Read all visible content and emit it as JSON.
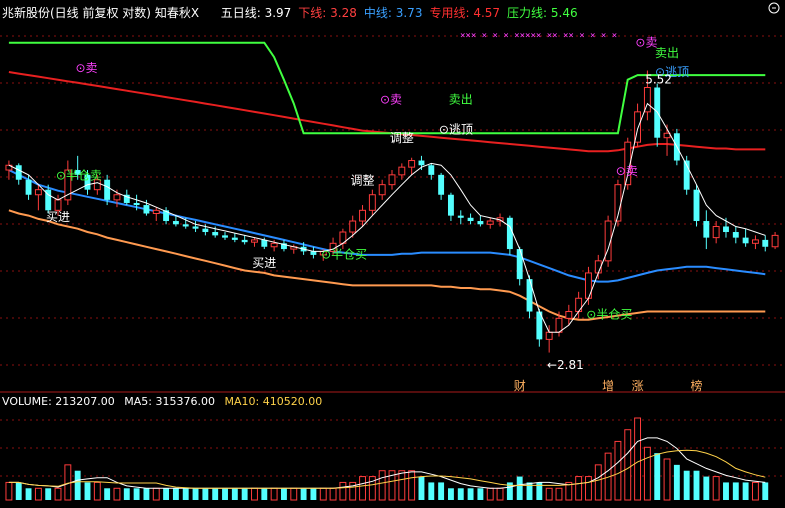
{
  "header": {
    "title": "兆新股份(日线 前复权 对数)",
    "indicator": "知春秋X",
    "items": [
      {
        "label": "五日线",
        "value": "3.97",
        "color": "#ffffff"
      },
      {
        "label": "下线",
        "value": "3.28",
        "color": "#ff4040"
      },
      {
        "label": "中线",
        "value": "3.73",
        "color": "#3aa0ff"
      },
      {
        "label": "专用线",
        "value": "4.57",
        "color": "#ff3030"
      },
      {
        "label": "压力线",
        "value": "5.46",
        "color": "#40ff40"
      }
    ]
  },
  "volume_header": {
    "volume_label": "VOLUME",
    "volume_value": "213207.00",
    "ma5_label": "MA5",
    "ma5_value": "315376.00",
    "ma10_label": "MA10",
    "ma10_value": "410520.00"
  },
  "colors": {
    "up": "#ff3c3c",
    "down": "#54ffff",
    "pressure": "#40ff40",
    "special": "#e82020",
    "mid": "#2a8cff",
    "lower": "#ff9a50",
    "five_day": "#ffffff",
    "sell_marker": "#ff40ff",
    "green_text": "#40ff40",
    "white_text": "#ffffff"
  },
  "chart_data": {
    "type": "candlestick",
    "price_scale": "log",
    "ylim": [
      2.6,
      6.2
    ],
    "candles": [
      {
        "o": 4.35,
        "h": 4.45,
        "l": 4.25,
        "c": 4.4
      },
      {
        "o": 4.4,
        "h": 4.42,
        "l": 4.2,
        "c": 4.25
      },
      {
        "o": 4.25,
        "h": 4.3,
        "l": 4.05,
        "c": 4.1
      },
      {
        "o": 4.1,
        "h": 4.2,
        "l": 3.95,
        "c": 4.15
      },
      {
        "o": 4.15,
        "h": 4.2,
        "l": 3.92,
        "c": 3.95
      },
      {
        "o": 3.95,
        "h": 4.1,
        "l": 3.9,
        "c": 4.05
      },
      {
        "o": 4.05,
        "h": 4.45,
        "l": 4.0,
        "c": 4.35
      },
      {
        "o": 4.35,
        "h": 4.5,
        "l": 4.25,
        "c": 4.3
      },
      {
        "o": 4.3,
        "h": 4.35,
        "l": 4.1,
        "c": 4.15
      },
      {
        "o": 4.15,
        "h": 4.3,
        "l": 4.1,
        "c": 4.25
      },
      {
        "o": 4.25,
        "h": 4.3,
        "l": 4.0,
        "c": 4.05
      },
      {
        "o": 4.05,
        "h": 4.15,
        "l": 3.98,
        "c": 4.1
      },
      {
        "o": 4.1,
        "h": 4.15,
        "l": 4.0,
        "c": 4.02
      },
      {
        "o": 4.02,
        "h": 4.1,
        "l": 3.95,
        "c": 4.0
      },
      {
        "o": 4.0,
        "h": 4.05,
        "l": 3.9,
        "c": 3.92
      },
      {
        "o": 3.92,
        "h": 3.98,
        "l": 3.85,
        "c": 3.95
      },
      {
        "o": 3.95,
        "h": 3.98,
        "l": 3.82,
        "c": 3.85
      },
      {
        "o": 3.85,
        "h": 3.9,
        "l": 3.8,
        "c": 3.82
      },
      {
        "o": 3.82,
        "h": 3.88,
        "l": 3.78,
        "c": 3.8
      },
      {
        "o": 3.8,
        "h": 3.85,
        "l": 3.75,
        "c": 3.78
      },
      {
        "o": 3.78,
        "h": 3.82,
        "l": 3.72,
        "c": 3.75
      },
      {
        "o": 3.75,
        "h": 3.8,
        "l": 3.7,
        "c": 3.72
      },
      {
        "o": 3.72,
        "h": 3.75,
        "l": 3.68,
        "c": 3.7
      },
      {
        "o": 3.7,
        "h": 3.74,
        "l": 3.66,
        "c": 3.68
      },
      {
        "o": 3.68,
        "h": 3.72,
        "l": 3.64,
        "c": 3.66
      },
      {
        "o": 3.66,
        "h": 3.7,
        "l": 3.62,
        "c": 3.68
      },
      {
        "o": 3.68,
        "h": 3.7,
        "l": 3.6,
        "c": 3.62
      },
      {
        "o": 3.62,
        "h": 3.68,
        "l": 3.58,
        "c": 3.65
      },
      {
        "o": 3.65,
        "h": 3.68,
        "l": 3.58,
        "c": 3.6
      },
      {
        "o": 3.6,
        "h": 3.64,
        "l": 3.56,
        "c": 3.62
      },
      {
        "o": 3.62,
        "h": 3.66,
        "l": 3.55,
        "c": 3.58
      },
      {
        "o": 3.58,
        "h": 3.62,
        "l": 3.52,
        "c": 3.55
      },
      {
        "o": 3.55,
        "h": 3.6,
        "l": 3.5,
        "c": 3.58
      },
      {
        "o": 3.58,
        "h": 3.7,
        "l": 3.55,
        "c": 3.65
      },
      {
        "o": 3.65,
        "h": 3.78,
        "l": 3.6,
        "c": 3.75
      },
      {
        "o": 3.75,
        "h": 3.9,
        "l": 3.7,
        "c": 3.85
      },
      {
        "o": 3.85,
        "h": 4.0,
        "l": 3.8,
        "c": 3.95
      },
      {
        "o": 3.95,
        "h": 4.15,
        "l": 3.9,
        "c": 4.1
      },
      {
        "o": 4.1,
        "h": 4.25,
        "l": 4.05,
        "c": 4.2
      },
      {
        "o": 4.2,
        "h": 4.35,
        "l": 4.15,
        "c": 4.3
      },
      {
        "o": 4.3,
        "h": 4.42,
        "l": 4.25,
        "c": 4.38
      },
      {
        "o": 4.38,
        "h": 4.48,
        "l": 4.3,
        "c": 4.45
      },
      {
        "o": 4.45,
        "h": 4.5,
        "l": 4.35,
        "c": 4.4
      },
      {
        "o": 4.4,
        "h": 4.42,
        "l": 4.25,
        "c": 4.3
      },
      {
        "o": 4.3,
        "h": 4.32,
        "l": 4.05,
        "c": 4.1
      },
      {
        "o": 4.1,
        "h": 4.12,
        "l": 3.85,
        "c": 3.9
      },
      {
        "o": 3.9,
        "h": 3.95,
        "l": 3.82,
        "c": 3.88
      },
      {
        "o": 3.88,
        "h": 3.92,
        "l": 3.82,
        "c": 3.85
      },
      {
        "o": 3.85,
        "h": 3.9,
        "l": 3.8,
        "c": 3.82
      },
      {
        "o": 3.82,
        "h": 3.88,
        "l": 3.78,
        "c": 3.85
      },
      {
        "o": 3.85,
        "h": 3.92,
        "l": 3.8,
        "c": 3.88
      },
      {
        "o": 3.88,
        "h": 3.9,
        "l": 3.55,
        "c": 3.6
      },
      {
        "o": 3.6,
        "h": 3.62,
        "l": 3.3,
        "c": 3.35
      },
      {
        "o": 3.35,
        "h": 3.38,
        "l": 3.05,
        "c": 3.1
      },
      {
        "o": 3.1,
        "h": 3.12,
        "l": 2.85,
        "c": 2.9
      },
      {
        "o": 2.9,
        "h": 3.0,
        "l": 2.81,
        "c": 2.95
      },
      {
        "o": 2.95,
        "h": 3.1,
        "l": 2.92,
        "c": 3.05
      },
      {
        "o": 3.05,
        "h": 3.15,
        "l": 3.0,
        "c": 3.1
      },
      {
        "o": 3.1,
        "h": 3.25,
        "l": 3.05,
        "c": 3.2
      },
      {
        "o": 3.2,
        "h": 3.45,
        "l": 3.15,
        "c": 3.4
      },
      {
        "o": 3.4,
        "h": 3.55,
        "l": 3.35,
        "c": 3.5
      },
      {
        "o": 3.5,
        "h": 3.9,
        "l": 3.45,
        "c": 3.85
      },
      {
        "o": 3.85,
        "h": 4.25,
        "l": 3.8,
        "c": 4.2
      },
      {
        "o": 4.2,
        "h": 4.7,
        "l": 4.15,
        "c": 4.65
      },
      {
        "o": 4.65,
        "h": 5.1,
        "l": 4.6,
        "c": 5.0
      },
      {
        "o": 5.0,
        "h": 5.52,
        "l": 4.9,
        "c": 5.3
      },
      {
        "o": 5.3,
        "h": 5.35,
        "l": 4.6,
        "c": 4.7
      },
      {
        "o": 4.7,
        "h": 4.85,
        "l": 4.5,
        "c": 4.75
      },
      {
        "o": 4.75,
        "h": 4.8,
        "l": 4.4,
        "c": 4.45
      },
      {
        "o": 4.45,
        "h": 4.5,
        "l": 4.1,
        "c": 4.15
      },
      {
        "o": 4.15,
        "h": 4.2,
        "l": 3.8,
        "c": 3.85
      },
      {
        "o": 3.85,
        "h": 3.95,
        "l": 3.6,
        "c": 3.7
      },
      {
        "o": 3.7,
        "h": 3.85,
        "l": 3.65,
        "c": 3.8
      },
      {
        "o": 3.8,
        "h": 3.88,
        "l": 3.7,
        "c": 3.75
      },
      {
        "o": 3.75,
        "h": 3.8,
        "l": 3.65,
        "c": 3.7
      },
      {
        "o": 3.7,
        "h": 3.78,
        "l": 3.62,
        "c": 3.65
      },
      {
        "o": 3.65,
        "h": 3.72,
        "l": 3.6,
        "c": 3.68
      },
      {
        "o": 3.68,
        "h": 3.72,
        "l": 3.58,
        "c": 3.62
      },
      {
        "o": 3.62,
        "h": 3.75,
        "l": 3.6,
        "c": 3.72
      }
    ],
    "volumes": [
      3,
      3,
      2,
      2,
      2,
      2,
      6,
      5,
      3,
      3,
      2,
      2,
      2,
      2,
      2,
      2,
      2,
      2,
      2,
      2,
      2,
      2,
      2,
      2,
      2,
      2,
      2,
      2,
      2,
      2,
      2,
      2,
      2,
      2,
      3,
      3,
      4,
      4,
      5,
      5,
      5,
      5,
      4,
      3,
      3,
      2,
      2,
      2,
      2,
      2,
      2,
      3,
      4,
      3,
      3,
      2,
      2,
      3,
      4,
      4,
      6,
      8,
      10,
      12,
      14,
      9,
      8,
      7,
      6,
      5,
      5,
      4,
      4,
      3,
      3,
      3,
      3,
      3
    ],
    "lines": {
      "pressure": [
        5.9,
        5.9,
        5.9,
        5.9,
        5.9,
        5.9,
        5.9,
        5.9,
        5.9,
        5.9,
        5.9,
        5.9,
        5.9,
        5.9,
        5.9,
        5.9,
        5.9,
        5.9,
        5.9,
        5.9,
        5.9,
        5.9,
        5.9,
        5.9,
        5.9,
        5.9,
        5.9,
        5.7,
        5.4,
        5.1,
        4.75,
        4.75,
        4.75,
        4.75,
        4.75,
        4.75,
        4.75,
        4.75,
        4.75,
        4.75,
        4.75,
        4.75,
        4.75,
        4.75,
        4.75,
        4.75,
        4.75,
        4.75,
        4.75,
        4.75,
        4.75,
        4.75,
        4.75,
        4.75,
        4.75,
        4.75,
        4.75,
        4.75,
        4.75,
        4.75,
        4.75,
        4.75,
        4.75,
        5.4,
        5.46,
        5.46,
        5.46,
        5.46,
        5.46,
        5.46,
        5.46,
        5.46,
        5.46,
        5.46,
        5.46,
        5.46,
        5.46,
        5.46
      ],
      "special": [
        5.5,
        5.48,
        5.46,
        5.44,
        5.42,
        5.4,
        5.38,
        5.36,
        5.34,
        5.32,
        5.3,
        5.28,
        5.26,
        5.24,
        5.22,
        5.2,
        5.18,
        5.16,
        5.14,
        5.12,
        5.1,
        5.08,
        5.06,
        5.04,
        5.02,
        5.0,
        4.98,
        4.96,
        4.94,
        4.92,
        4.9,
        4.88,
        4.86,
        4.84,
        4.82,
        4.8,
        4.78,
        4.77,
        4.76,
        4.75,
        4.74,
        4.73,
        4.72,
        4.71,
        4.7,
        4.69,
        4.68,
        4.67,
        4.66,
        4.65,
        4.64,
        4.63,
        4.62,
        4.61,
        4.6,
        4.59,
        4.58,
        4.57,
        4.56,
        4.55,
        4.55,
        4.55,
        4.56,
        4.58,
        4.6,
        4.62,
        4.63,
        4.63,
        4.62,
        4.61,
        4.6,
        4.59,
        4.58,
        4.58,
        4.57,
        4.57,
        4.57,
        4.57
      ],
      "mid": [
        4.35,
        4.3,
        4.25,
        4.2,
        4.17,
        4.14,
        4.12,
        4.1,
        4.08,
        4.06,
        4.04,
        4.02,
        4.0,
        3.98,
        3.96,
        3.94,
        3.92,
        3.9,
        3.88,
        3.86,
        3.84,
        3.82,
        3.8,
        3.78,
        3.76,
        3.74,
        3.72,
        3.7,
        3.68,
        3.66,
        3.64,
        3.62,
        3.6,
        3.58,
        3.57,
        3.56,
        3.55,
        3.55,
        3.55,
        3.55,
        3.56,
        3.56,
        3.57,
        3.57,
        3.57,
        3.57,
        3.57,
        3.57,
        3.57,
        3.57,
        3.56,
        3.55,
        3.53,
        3.5,
        3.47,
        3.44,
        3.41,
        3.38,
        3.36,
        3.34,
        3.33,
        3.33,
        3.34,
        3.36,
        3.38,
        3.4,
        3.42,
        3.43,
        3.44,
        3.45,
        3.45,
        3.45,
        3.44,
        3.43,
        3.42,
        3.41,
        3.4,
        3.39
      ],
      "lower": [
        3.95,
        3.92,
        3.9,
        3.87,
        3.85,
        3.82,
        3.8,
        3.78,
        3.75,
        3.73,
        3.7,
        3.68,
        3.66,
        3.64,
        3.62,
        3.6,
        3.58,
        3.56,
        3.54,
        3.52,
        3.5,
        3.48,
        3.46,
        3.44,
        3.42,
        3.41,
        3.4,
        3.38,
        3.37,
        3.36,
        3.35,
        3.34,
        3.33,
        3.32,
        3.31,
        3.3,
        3.3,
        3.3,
        3.3,
        3.3,
        3.3,
        3.3,
        3.3,
        3.3,
        3.29,
        3.29,
        3.28,
        3.28,
        3.27,
        3.27,
        3.26,
        3.25,
        3.22,
        3.18,
        3.14,
        3.1,
        3.07,
        3.05,
        3.04,
        3.04,
        3.05,
        3.06,
        3.07,
        3.08,
        3.09,
        3.1,
        3.1,
        3.1,
        3.1,
        3.1,
        3.1,
        3.1,
        3.1,
        3.1,
        3.1,
        3.1,
        3.1,
        3.1
      ],
      "five_day": [
        4.4,
        4.35,
        4.3,
        4.2,
        4.1,
        4.05,
        4.1,
        4.15,
        4.2,
        4.22,
        4.18,
        4.12,
        4.08,
        4.05,
        4.02,
        3.98,
        3.94,
        3.9,
        3.86,
        3.82,
        3.8,
        3.78,
        3.76,
        3.74,
        3.72,
        3.7,
        3.68,
        3.66,
        3.64,
        3.62,
        3.6,
        3.58,
        3.58,
        3.6,
        3.65,
        3.72,
        3.8,
        3.9,
        4.0,
        4.1,
        4.2,
        4.3,
        4.38,
        4.42,
        4.4,
        4.3,
        4.15,
        4.0,
        3.9,
        3.88,
        3.86,
        3.8,
        3.6,
        3.35,
        3.1,
        2.95,
        2.95,
        3.0,
        3.1,
        3.2,
        3.4,
        3.6,
        3.9,
        4.3,
        4.8,
        5.1,
        5.0,
        4.8,
        4.6,
        4.4,
        4.2,
        4.0,
        3.9,
        3.85,
        3.8,
        3.78,
        3.75,
        3.72
      ]
    },
    "annotations": [
      {
        "text": "⊙卖",
        "idx": 8,
        "price": 5.5,
        "color": "#ff40ff"
      },
      {
        "text": "⊙半仓卖",
        "idx": 6,
        "price": 4.25,
        "color": "#40ff40"
      },
      {
        "text": "买进",
        "idx": 5,
        "price": 3.85,
        "color": "#ffffff"
      },
      {
        "text": "买进",
        "idx": 26,
        "price": 3.45,
        "color": "#ffffff"
      },
      {
        "text": "⊙卖",
        "idx": 39,
        "price": 5.1,
        "color": "#ff40ff"
      },
      {
        "text": "卖出",
        "idx": 46,
        "price": 5.1,
        "color": "#40ff40"
      },
      {
        "text": "调整",
        "idx": 40,
        "price": 4.65,
        "color": "#ffffff"
      },
      {
        "text": "⊙逃顶",
        "idx": 45,
        "price": 4.75,
        "color": "#ffffff"
      },
      {
        "text": "调整",
        "idx": 36,
        "price": 4.2,
        "color": "#ffffff"
      },
      {
        "text": "⊙半仓买",
        "idx": 33,
        "price": 3.52,
        "color": "#40ff40"
      },
      {
        "text": "⊙卖",
        "idx": 63,
        "price": 4.3,
        "color": "#ff40ff"
      },
      {
        "text": "⊙卖",
        "idx": 65,
        "price": 5.85,
        "color": "#ff40ff"
      },
      {
        "text": "卖出",
        "idx": 67,
        "price": 5.7,
        "color": "#40ff40"
      },
      {
        "text": "⊙逃顶",
        "idx": 67,
        "price": 5.45,
        "color": "#3aa0ff"
      },
      {
        "text": "5.52",
        "idx": 66,
        "price": 5.35,
        "color": "#ffffff"
      },
      {
        "text": "⊙半仓买",
        "idx": 60,
        "price": 3.05,
        "color": "#40ff40"
      },
      {
        "text": "←2.81",
        "idx": 56,
        "price": 2.7,
        "color": "#ffffff"
      }
    ],
    "top_markers": "×××  ×  ×  ×  ××××× ××  ××  ×  ×  ×  ×",
    "event_labels": [
      {
        "text": "财",
        "idx": 52
      },
      {
        "text": "增",
        "idx": 61
      },
      {
        "text": "涨",
        "idx": 64
      },
      {
        "text": "榜",
        "idx": 70
      }
    ]
  }
}
